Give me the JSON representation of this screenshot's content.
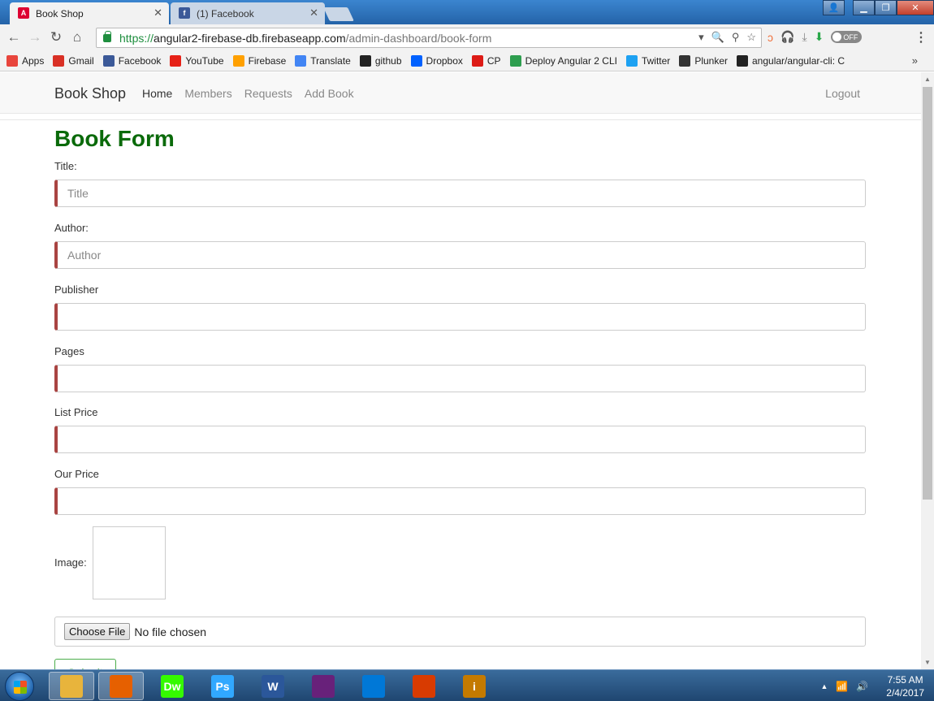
{
  "browser": {
    "tabs": [
      {
        "title": "Book Shop",
        "active": true
      },
      {
        "title": "(1) Facebook",
        "active": false
      }
    ],
    "url": {
      "scheme": "https://",
      "host": "angular2-firebase-db.firebaseapp.com",
      "path": "/admin-dashboard/book-form"
    },
    "toggle_label": "OFF",
    "bookmarks": [
      {
        "label": "Apps",
        "icon": "apps-grid-icon",
        "color": "#e8453c"
      },
      {
        "label": "Gmail",
        "icon": "gmail-icon",
        "color": "#d93025"
      },
      {
        "label": "Facebook",
        "icon": "facebook-icon",
        "color": "#3b5998"
      },
      {
        "label": "YouTube",
        "icon": "youtube-icon",
        "color": "#e62117"
      },
      {
        "label": "Firebase",
        "icon": "firebase-icon",
        "color": "#ffa000"
      },
      {
        "label": "Translate",
        "icon": "translate-icon",
        "color": "#4285f4"
      },
      {
        "label": "github",
        "icon": "github-icon",
        "color": "#222222"
      },
      {
        "label": "Dropbox",
        "icon": "dropbox-icon",
        "color": "#0061ff"
      },
      {
        "label": "CP",
        "icon": "cp-icon",
        "color": "#dd1b16"
      },
      {
        "label": "Deploy Angular 2 CLI",
        "icon": "deploy-icon",
        "color": "#2e9e4f"
      },
      {
        "label": "Twitter",
        "icon": "twitter-icon",
        "color": "#1da1f2"
      },
      {
        "label": "Plunker",
        "icon": "plunker-icon",
        "color": "#333333"
      },
      {
        "label": "angular/angular-cli: C",
        "icon": "github-icon",
        "color": "#222222"
      }
    ]
  },
  "site": {
    "brand": "Book Shop",
    "nav": [
      "Home",
      "Members",
      "Requests",
      "Add Book"
    ],
    "logout": "Logout"
  },
  "form": {
    "heading": "Book Form",
    "fields": [
      {
        "label": "Title:",
        "placeholder": "Title"
      },
      {
        "label": "Author:",
        "placeholder": "Author"
      },
      {
        "label": "Publisher",
        "placeholder": ""
      },
      {
        "label": "Pages",
        "placeholder": ""
      },
      {
        "label": "List Price",
        "placeholder": ""
      },
      {
        "label": "Our Price",
        "placeholder": ""
      }
    ],
    "image_label": "Image:",
    "file_button": "Choose File",
    "file_status": "No file chosen",
    "submit": "Submit"
  },
  "taskbar": {
    "apps": [
      {
        "icon": "file-explorer-icon",
        "color": "#e8b43c",
        "text": ""
      },
      {
        "icon": "firefox-icon",
        "color": "#e66000",
        "text": ""
      },
      {
        "icon": "dreamweaver-icon",
        "color": "#35fa00",
        "text": "Dw"
      },
      {
        "icon": "photoshop-icon",
        "color": "#31a8ff",
        "text": "Ps"
      },
      {
        "icon": "word-icon",
        "color": "#2b579a",
        "text": "W"
      },
      {
        "icon": "visual-studio-icon",
        "color": "#68217a",
        "text": ""
      },
      {
        "icon": "vscode-icon",
        "color": "#0078d7",
        "text": ""
      },
      {
        "icon": "office-icon",
        "color": "#d83b01",
        "text": ""
      },
      {
        "icon": "inpage-icon",
        "color": "#c47a00",
        "text": "i"
      }
    ],
    "time": "7:55 AM",
    "date": "2/4/2017"
  }
}
